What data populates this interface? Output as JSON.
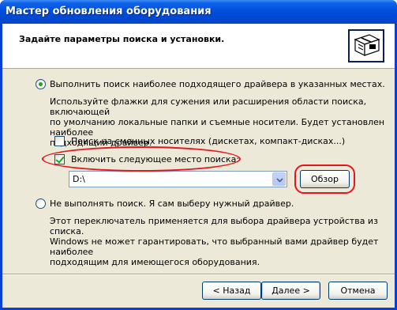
{
  "window": {
    "title": "Мастер обновления оборудования"
  },
  "header": {
    "heading": "Задайте параметры поиска и установки."
  },
  "options": {
    "search": {
      "label": "Выполнить поиск наиболее подходящего драйвера в указанных местах.",
      "checked": true,
      "description": [
        "Используйте флажки для сужения или расширения области поиска, включающей",
        "по умолчанию локальные папки и съемные носители. Будет установлен наиболее",
        "подходящий драйвер."
      ],
      "removable_media": {
        "label": "Поиск на сменных носителях (дискетах, компакт-дисках...)",
        "checked": false
      },
      "include_location": {
        "label": "Включить следующее место поиска:",
        "checked": true
      },
      "location_value": "D:\\",
      "browse_label": "Обзор"
    },
    "manual": {
      "label": "Не выполнять поиск. Я сам выберу нужный драйвер.",
      "checked": false,
      "description": [
        "Этот переключатель применяется для выбора драйвера устройства из списка.",
        "Windows не может гарантировать, что выбранный вами драйвер будет наиболее",
        "подходящим для имеющегося оборудования."
      ]
    }
  },
  "footer": {
    "back_label": "< Назад",
    "next_label": "Далее >",
    "cancel_label": "Отмена"
  },
  "colors": {
    "titlebar": "#0054e3",
    "dialog_bg": "#ece9d8",
    "annotation": "#e8141c",
    "check": "#21a121"
  }
}
